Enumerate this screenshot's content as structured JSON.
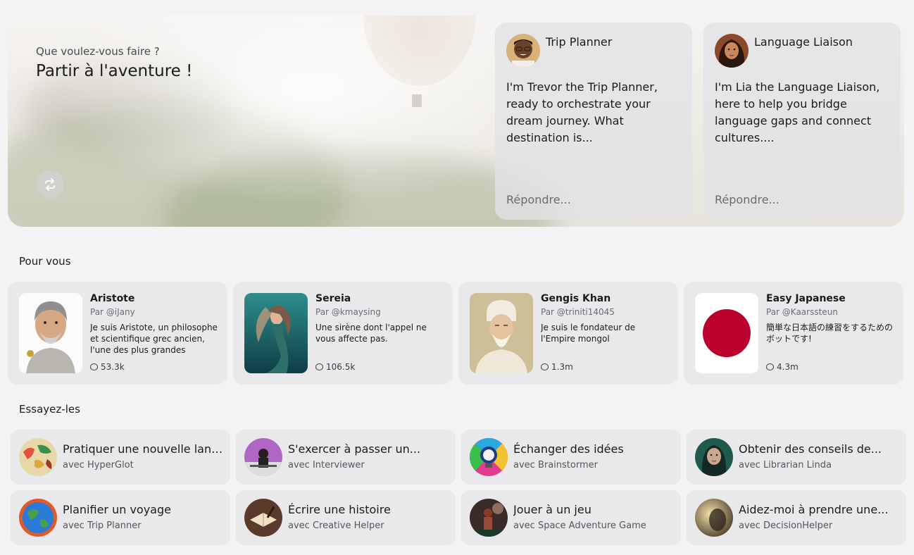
{
  "hero": {
    "prompt": "Que voulez-vous faire ?",
    "title": "Partir à l'aventure !",
    "refresh_icon": "refresh-icon",
    "cards": [
      {
        "name": "Trip Planner",
        "description": "I'm Trevor the Trip Planner, ready to orchestrate your dream journey. What destination is...",
        "reply_placeholder": "Répondre..."
      },
      {
        "name": "Language Liaison",
        "description": "I'm Lia the Language Liaison, here to help you bridge language gaps and connect cultures....",
        "reply_placeholder": "Répondre..."
      }
    ]
  },
  "for_you": {
    "title": "Pour vous",
    "bots": [
      {
        "name": "Aristote",
        "by": "Par @iJany",
        "description": "Je suis Aristote, un philosophe et scientifique grec ancien, l'une des plus grandes figures...",
        "count": "53.3k"
      },
      {
        "name": "Sereia",
        "by": "Par @kmaysing",
        "description": "Une sirène dont l'appel ne vous affecte pas.",
        "count": "106.5k"
      },
      {
        "name": "Gengis Khan",
        "by": "Par @triniti14045",
        "description": "Je suis le fondateur de l'Empire mongol",
        "count": "1.3m"
      },
      {
        "name": "Easy Japanese",
        "by": "Par @Kaarssteun",
        "description": "簡単な日本語の練習をするためのボットです!",
        "count": "4.3m"
      }
    ]
  },
  "try_these": {
    "title": "Essayez-les",
    "items": [
      {
        "title": "Pratiquer une nouvelle langue",
        "with": "avec HyperGlot"
      },
      {
        "title": "S'exercer à passer un...",
        "with": "avec Interviewer"
      },
      {
        "title": "Échanger des idées",
        "with": "avec Brainstormer"
      },
      {
        "title": "Obtenir des conseils de...",
        "with": "avec Librarian Linda"
      },
      {
        "title": "Planifier un voyage",
        "with": "avec Trip Planner"
      },
      {
        "title": "Écrire une histoire",
        "with": "avec Creative Helper"
      },
      {
        "title": "Jouer à un jeu",
        "with": "avec Space Adventure Game"
      },
      {
        "title": "Aidez-moi à prendre une...",
        "with": "avec DecisionHelper"
      }
    ]
  },
  "colors": {
    "background": "#f3f3f4",
    "card": "#e9e9ec",
    "japan_red": "#bc002d"
  }
}
